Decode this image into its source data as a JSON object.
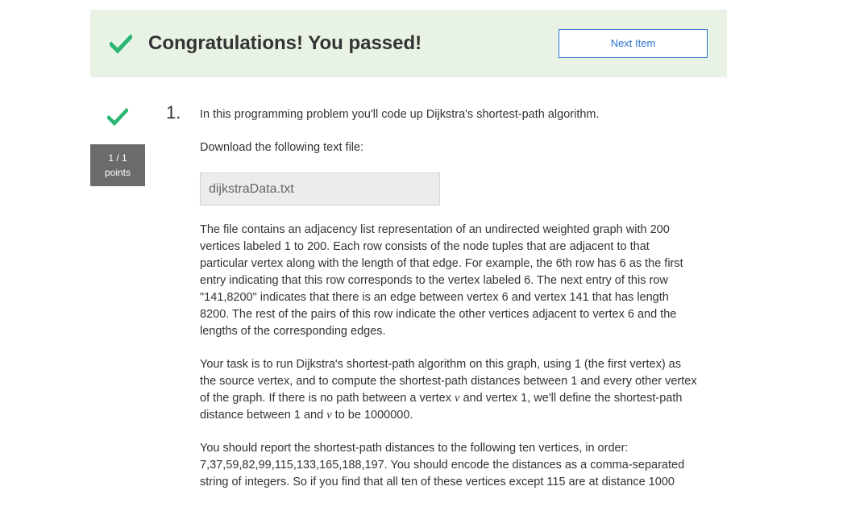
{
  "banner": {
    "title": "Congratulations! You passed!",
    "next_label": "Next Item"
  },
  "question": {
    "number": "1.",
    "score": "1 / 1",
    "score_unit": "points",
    "intro": "In this programming problem you'll code up Dijkstra's shortest-path algorithm.",
    "download_prompt": "Download the following text file:",
    "file_name": "dijkstraData.txt",
    "para_file": "The file contains an adjacency list representation of an undirected weighted graph with 200 vertices labeled 1 to 200. Each row consists of the node tuples that are adjacent to that particular vertex along with the length of that edge. For example, the 6th row has 6 as the first entry indicating that this row corresponds to the vertex labeled 6. The next entry of this row \"141,8200\" indicates that there is an edge between vertex 6 and vertex 141 that has length 8200. The rest of the pairs of this row indicate the other vertices adjacent to vertex 6 and the lengths of the corresponding edges.",
    "task_part1": "Your task is to run Dijkstra's shortest-path algorithm on this graph, using 1 (the first vertex) as the source vertex, and to compute the shortest-path distances between 1 and every other vertex of the graph. If there is no path between a vertex ",
    "task_var1": "v",
    "task_part2": " and vertex 1, we'll define the shortest-path distance between 1 and ",
    "task_var2": "v",
    "task_part3": " to be 1000000.",
    "report_text": "You should report the shortest-path distances to the following ten vertices, in order: 7,37,59,82,99,115,133,165,188,197. You should encode the distances as a comma-separated string of integers. So if you find that all ten of these vertices except 115 are at distance 1000"
  },
  "colors": {
    "success_green": "#2bb673",
    "banner_bg": "#e8f3e6",
    "link_blue": "#2a73cc",
    "score_bg": "#6b6b6b"
  },
  "icons": {
    "banner_icon": "check-icon",
    "question_icon": "check-icon"
  }
}
